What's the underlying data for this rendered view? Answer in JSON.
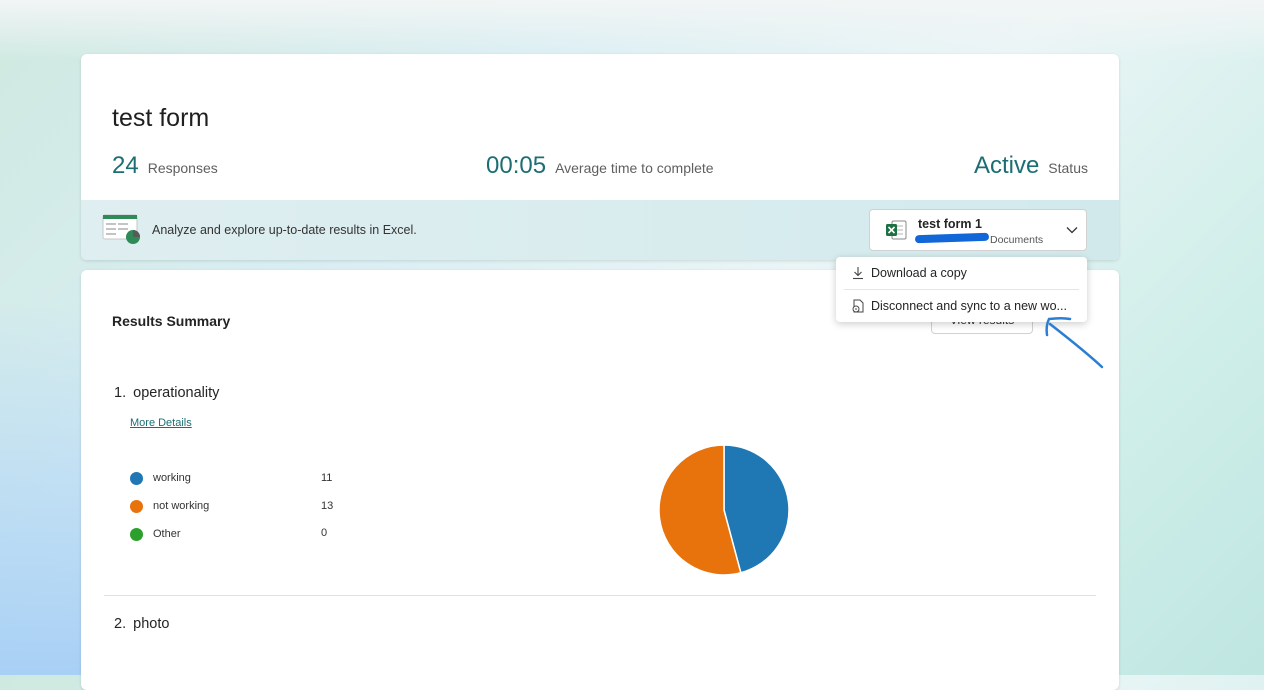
{
  "form": {
    "title": "test form",
    "responses": {
      "value": "24",
      "label": "Responses"
    },
    "avg_time": {
      "value": "00:05",
      "label": "Average time to complete"
    },
    "status": {
      "value": "Active",
      "label": "Status"
    }
  },
  "excel_bar": {
    "text": "Analyze and explore up-to-date results in Excel.",
    "workbook_name": "test form 1",
    "workbook_location": "Documents"
  },
  "menu": {
    "items": [
      {
        "label": "Download a copy",
        "icon": "download-icon"
      },
      {
        "label": "Disconnect and sync to a new wo...",
        "icon": "sync-document-icon"
      }
    ]
  },
  "results": {
    "title": "Results Summary",
    "view_results_label": "View results",
    "questions": [
      {
        "number": "1.",
        "title": "operationality",
        "more_details": "More Details",
        "options": [
          {
            "label": "working",
            "count": "11",
            "color": "#1f77b4"
          },
          {
            "label": "not working",
            "count": "13",
            "color": "#e8720c"
          },
          {
            "label": "Other",
            "count": "0",
            "color": "#2ca02c"
          }
        ]
      },
      {
        "number": "2.",
        "title": "photo"
      }
    ]
  },
  "chart_data": {
    "type": "pie",
    "categories": [
      "working",
      "not working",
      "Other"
    ],
    "values": [
      11,
      13,
      0
    ],
    "colors": [
      "#1f77b4",
      "#e8720c",
      "#2ca02c"
    ]
  }
}
